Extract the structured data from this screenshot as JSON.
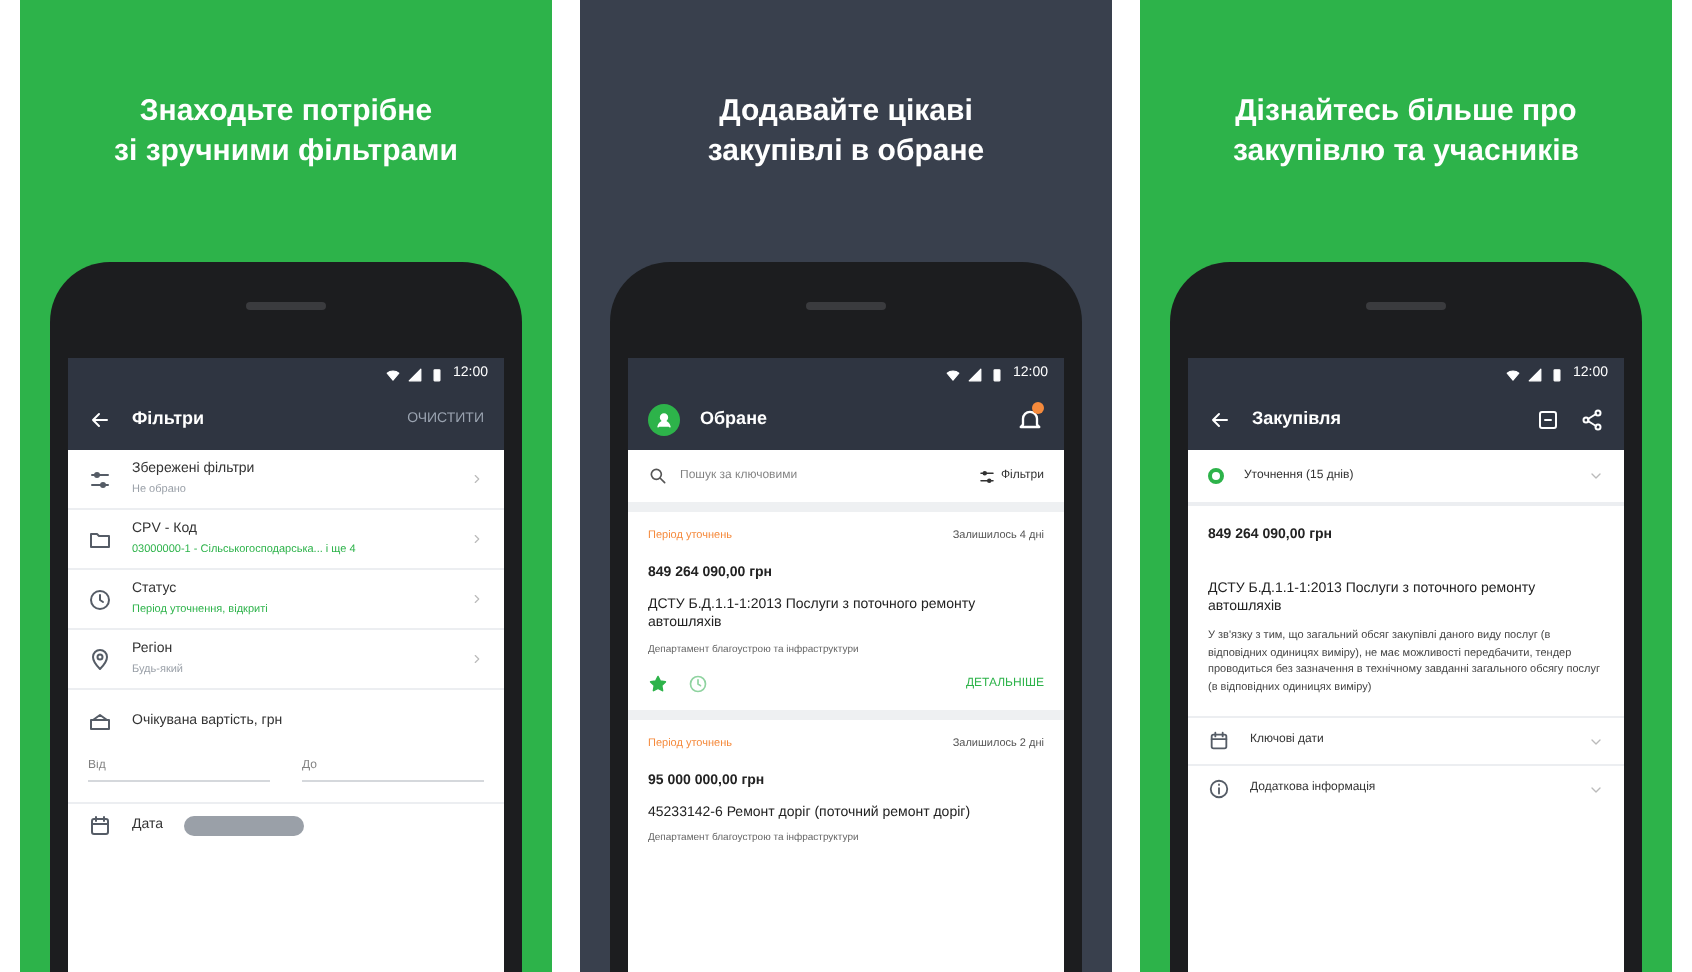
{
  "panels": [
    {
      "kind": "green",
      "headline": "Знаходьте потрібне\nзі зручними фільтрами",
      "screen": {
        "kind": "filters",
        "time": "12:00",
        "title": "Фільтри",
        "action": "ОЧИСТИТИ",
        "items": [
          {
            "title": "Збережені фільтри",
            "subtitle": "Не обрано",
            "highlighted": false
          },
          {
            "title": "CPV - Код",
            "subtitle": "03000000-1 - Сільськогосподарська... і ще 4",
            "highlighted": true
          },
          {
            "title": "Статус",
            "subtitle": "Період уточнення, відкриті",
            "highlighted": true
          },
          {
            "title": "Регіон",
            "subtitle": "Будь-який",
            "highlighted": false
          }
        ],
        "range": {
          "label": "Очікувана вартість, грн",
          "from": {
            "placeholder": "Від"
          },
          "to": {
            "placeholder": "До"
          }
        },
        "date_label": "Дата"
      }
    },
    {
      "kind": "dark",
      "headline": "Додавайте цікаві\nзакупівлі в обране",
      "screen": {
        "kind": "favorites",
        "time": "12:00",
        "title": "Обране",
        "search": {
          "placeholder": "Пошук за ключовими"
        },
        "filter_label": "Фільтри",
        "cards": [
          {
            "status": "Період уточнень",
            "remaining": "Залишилось 4 дні",
            "amount": "849 264 090,00 грн",
            "title": "ДСТУ Б.Д.1.1-1:2013 Послуги з поточного ремонту автошляхів",
            "buyer": "Департамент благоустрою та інфраструктури",
            "favorite": true,
            "details": "ДЕТАЛЬНІШЕ"
          },
          {
            "status": "Період уточнень",
            "remaining": "Залишилось 2 дні",
            "amount": "95 000 000,00 грн",
            "title": "45233142-6 Ремонт доріг (поточний ремонт доріг)",
            "buyer": "Департамент благоустрою та інфраструктури"
          }
        ]
      }
    },
    {
      "kind": "green",
      "headline": "Дізнайтесь більше про\nзакупівлю та учасників",
      "screen": {
        "kind": "tender",
        "time": "12:00",
        "title": "Закупівля",
        "status": "Уточнення (15 днів)",
        "amount": "849 264 090,00 грн",
        "title_text": "ДСТУ Б.Д.1.1-1:2013 Послуги з поточного ремонту автошляхів",
        "description": "У зв'язку з тим, що загальний обсяг закупівлі даного виду послуг (в відповідних одиницях виміру), не має можливості передбачити, тендер проводиться без зазначення в технічному завданні загального обсягу послуг (в відповідних одиницях виміру)",
        "sections": [
          {
            "label": "Ключові дати",
            "expanded": false
          },
          {
            "label": "Додаткова інформація",
            "expanded": false
          }
        ]
      }
    }
  ]
}
